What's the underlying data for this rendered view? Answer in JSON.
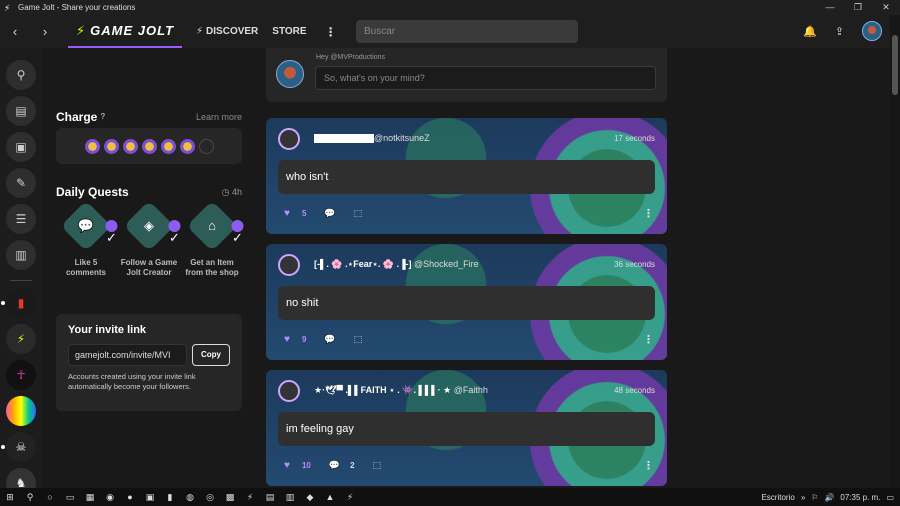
{
  "window": {
    "title": "Game Jolt - Share your creations"
  },
  "nav": {
    "brand": "GAME JOLT",
    "discover": "DISCOVER",
    "store": "STORE",
    "search_placeholder": "Buscar"
  },
  "charge": {
    "title": "Charge",
    "learn_more": "Learn more",
    "filled": 6,
    "total": 7
  },
  "quests": {
    "title": "Daily Quests",
    "time_left": "4h",
    "items": [
      {
        "label": "Like 5 comments",
        "icon": "comments-icon"
      },
      {
        "label": "Follow a Game Jolt Creator",
        "icon": "creator-icon"
      },
      {
        "label": "Get an Item from the shop",
        "icon": "shop-icon"
      }
    ]
  },
  "invite": {
    "title": "Your invite link",
    "url": "gamejolt.com/invite/MVI",
    "copy_label": "Copy",
    "description": "Accounts created using your invite link automatically become your followers."
  },
  "composer": {
    "greeting": "Hey @MVProductions",
    "placeholder": "So, what's on your mind?"
  },
  "posts": [
    {
      "name": "",
      "handle": "@notkitsuneZ",
      "time": "17 seconds",
      "text": "who isn't",
      "likes": "5",
      "comments": ""
    },
    {
      "name": "[-▌. 🌸 .⋆Fear⋆. 🌸 .▐-]",
      "handle": "@Shocked_Fire",
      "time": "36 seconds",
      "text": "no shit",
      "likes": "9",
      "comments": ""
    },
    {
      "name": "★·🕊▀ .▌▌FAITH ⋆ . 👾. ▌▌▌· ★",
      "handle": "@Faithh",
      "time": "48 seconds",
      "text": "im feeling gay",
      "likes": "10",
      "comments": "2"
    }
  ],
  "taskbar": {
    "desktop_label": "Escritorio",
    "time": "07:35 p. m."
  }
}
